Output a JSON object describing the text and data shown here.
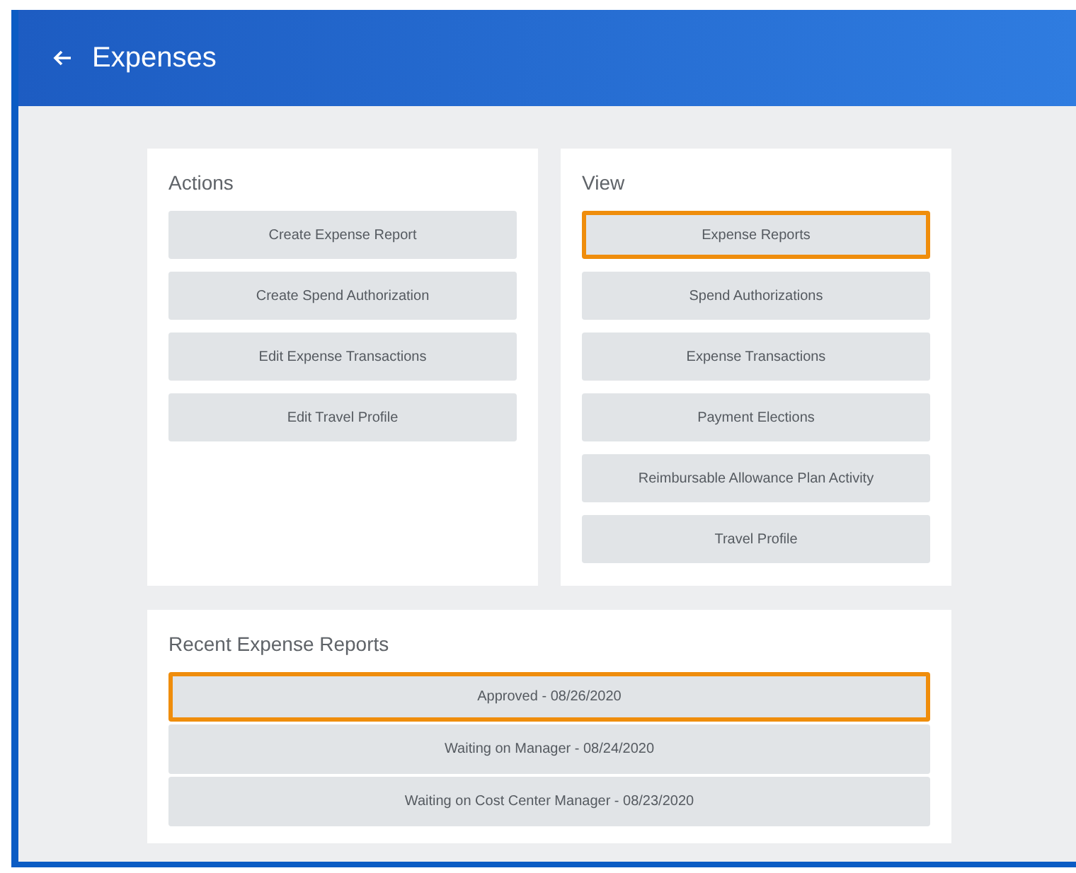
{
  "header": {
    "title": "Expenses"
  },
  "actions": {
    "title": "Actions",
    "items": [
      {
        "label": "Create Expense Report",
        "selected": false
      },
      {
        "label": "Create Spend Authorization",
        "selected": false
      },
      {
        "label": "Edit Expense Transactions",
        "selected": false
      },
      {
        "label": "Edit Travel Profile",
        "selected": false
      }
    ]
  },
  "view": {
    "title": "View",
    "items": [
      {
        "label": "Expense Reports",
        "selected": true
      },
      {
        "label": "Spend Authorizations",
        "selected": false
      },
      {
        "label": "Expense Transactions",
        "selected": false
      },
      {
        "label": "Payment Elections",
        "selected": false
      },
      {
        "label": "Reimbursable Allowance Plan Activity",
        "selected": false
      },
      {
        "label": "Travel Profile",
        "selected": false
      }
    ]
  },
  "recent": {
    "title": "Recent Expense Reports",
    "items": [
      {
        "label": "Approved - 08/26/2020",
        "selected": true
      },
      {
        "label": "Waiting on Manager - 08/24/2020",
        "selected": false
      },
      {
        "label": "Waiting on Cost Center Manager - 08/23/2020",
        "selected": false
      }
    ]
  }
}
